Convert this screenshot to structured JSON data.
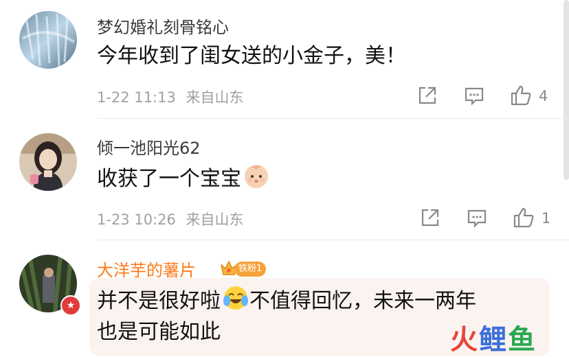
{
  "comments": [
    {
      "username": "梦幻婚礼刻骨铭心",
      "text": "今年收到了闺女送的小金子，美！",
      "date": "1-22 11:13",
      "location": "来自山东",
      "likes": "4"
    },
    {
      "username": "倾一池阳光62",
      "text": "收获了一个宝宝",
      "emoji": "baby-face",
      "date": "1-23 10:26",
      "location": "来自山东",
      "likes": "1"
    },
    {
      "username": "大洋芋的薯片",
      "badge": "铁粉1",
      "text_line1_a": "并不是很好啦",
      "emoji": "laughing-crying",
      "text_line1_b": "不值得回忆，未来一两年",
      "text_line2": "也是可能如此"
    }
  ],
  "watermark": {
    "part1": "火",
    "part2": "鲤",
    "part3": "鱼"
  },
  "colors": {
    "highlight_name": "#ff7a1a",
    "meta": "#a0a0a0",
    "badge": "#f6a33a"
  }
}
